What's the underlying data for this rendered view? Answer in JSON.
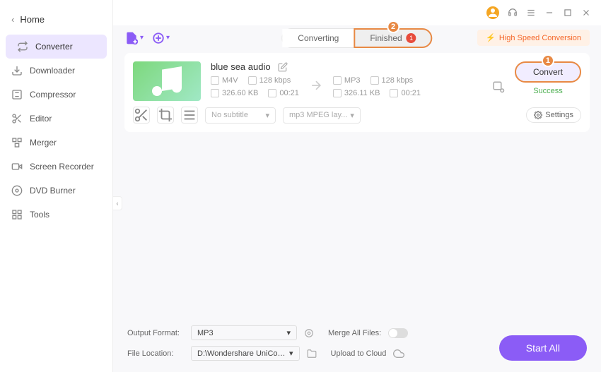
{
  "home": "Home",
  "nav": [
    "Converter",
    "Downloader",
    "Compressor",
    "Editor",
    "Merger",
    "Screen Recorder",
    "DVD Burner",
    "Tools"
  ],
  "tabs": {
    "converting": "Converting",
    "finished": "Finished",
    "finished_count": "1"
  },
  "callout": {
    "step1": "1",
    "step2": "2"
  },
  "hsc": "High Speed Conversion",
  "file": {
    "title": "blue sea audio",
    "src": {
      "fmt": "M4V",
      "br": "128 kbps",
      "size": "326.60 KB",
      "dur": "00:21"
    },
    "dst": {
      "fmt": "MP3",
      "br": "128 kbps",
      "size": "326.11 KB",
      "dur": "00:21"
    },
    "convert": "Convert",
    "status": "Success"
  },
  "subtitle": "No subtitle",
  "audio_sel": "mp3 MPEG lay...",
  "settings": "Settings",
  "footer": {
    "out_fmt_lbl": "Output Format:",
    "out_fmt": "MP3",
    "loc_lbl": "File Location:",
    "loc": "D:\\Wondershare UniConverter 1",
    "merge": "Merge All Files:",
    "cloud": "Upload to Cloud",
    "start": "Start All"
  }
}
